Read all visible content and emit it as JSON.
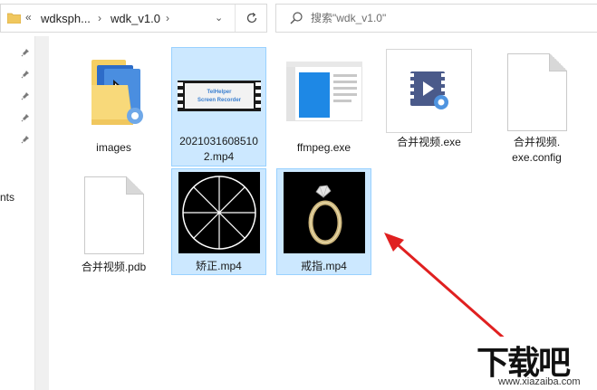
{
  "address": {
    "collapse": "«",
    "crumbs": [
      "wdksph...",
      "wdk_v1.0"
    ],
    "separator": "›",
    "dropdown": "⌄"
  },
  "search": {
    "placeholder": "搜索\"wdk_v1.0\""
  },
  "nav": {
    "partial_label": "nts"
  },
  "items": [
    {
      "name": "images",
      "type": "folder"
    },
    {
      "name": "20210316085102.mp4",
      "type": "video",
      "selected": true
    },
    {
      "name": "ffmpeg.exe",
      "type": "exe"
    },
    {
      "name": "合并视频.exe",
      "type": "exe-video"
    },
    {
      "name": "合并视频.exe.config",
      "type": "file"
    },
    {
      "name": "合并视频.pdb",
      "type": "file"
    },
    {
      "name": "矫正.mp4",
      "type": "video",
      "selected": true
    },
    {
      "name": "戒指.mp4",
      "type": "video",
      "selected": true
    }
  ],
  "labels": {
    "i0": "images",
    "i1a": "2021031608510",
    "i1b": "2.mp4",
    "i2": "ffmpeg.exe",
    "i3": "合并视频.exe",
    "i4a": "合并视频.",
    "i4b": "exe.config",
    "i5": "合并视频.pdb",
    "i6": "矫正.mp4",
    "i7": "戒指.mp4"
  },
  "video_thumb_text": {
    "line1": "TelHelper",
    "line2": "Screen Recorder"
  },
  "watermark": {
    "main": "下载吧",
    "url": "www.xiazaiba.com"
  },
  "colors": {
    "selection": "#cce8ff",
    "selection_border": "#99d1ff",
    "arrow": "#e02020"
  }
}
